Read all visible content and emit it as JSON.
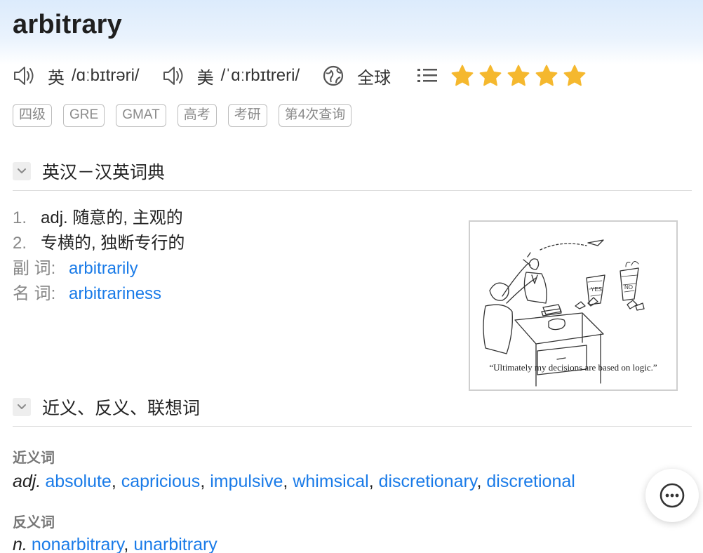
{
  "word": "arbitrary",
  "pronunciations": [
    {
      "region": "英",
      "ipa": "/ɑːbɪtrəri/"
    },
    {
      "region": "美",
      "ipa": "/ˈɑːrbɪtreri/"
    }
  ],
  "global_label": "全球",
  "star_rating": 5,
  "tags": [
    "四级",
    "GRE",
    "GMAT",
    "高考",
    "考研",
    "第4次查询"
  ],
  "dictionary_section": {
    "title": "英汉－汉英词典",
    "definitions": [
      {
        "num": "1.",
        "text": "adj. 随意的, 主观的"
      },
      {
        "num": "2.",
        "text": "专横的, 独断专行的"
      }
    ],
    "derivatives": [
      {
        "label": "副 词:",
        "word": "arbitrarily"
      },
      {
        "label": "名 词:",
        "word": "arbitrariness"
      }
    ],
    "cartoon_caption": "“Ultimately my decisions are based on logic.”",
    "cartoon_bin_labels": [
      "YES",
      "NO"
    ]
  },
  "synonyms_section": {
    "title": "近义、反义、联想词",
    "synonyms_label": "近义词",
    "synonyms_pos": "adj.",
    "synonyms": [
      "absolute",
      "capricious",
      "impulsive",
      "whimsical",
      "discretionary",
      "discretional"
    ],
    "antonyms_label": "反义词",
    "antonyms_pos": "n.",
    "antonyms": [
      "nonarbitrary",
      "unarbitrary"
    ]
  },
  "colors": {
    "link": "#1a7be8",
    "star": "#f5b82e",
    "header_gradient_top": "#dcebfc"
  },
  "icons": [
    "speaker-icon",
    "globe-icon",
    "list-icon",
    "star-icon",
    "chevron-down-icon",
    "chat-bubble-icon"
  ]
}
